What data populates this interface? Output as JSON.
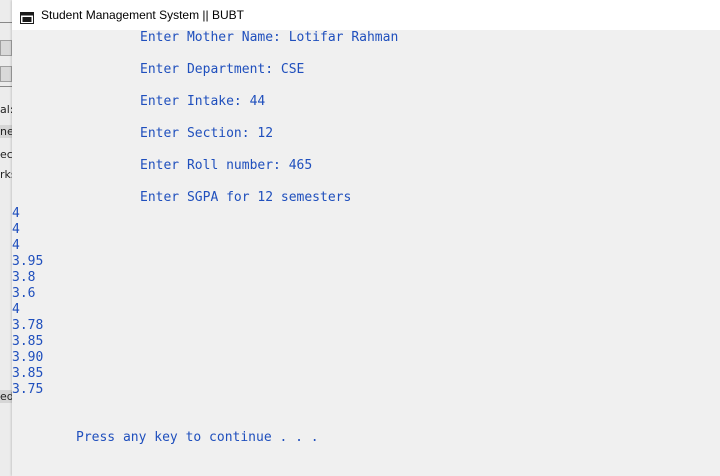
{
  "window": {
    "title": "Student Management System || BUBT",
    "icon": "console-app-icon"
  },
  "background_window": {
    "fragments": [
      "al:",
      "ner",
      "ect",
      "rks",
      "ed"
    ]
  },
  "console": {
    "prompts": [
      "Enter Mother Name: Lotifar Rahman",
      "Enter Department: CSE",
      "Enter Intake: 44",
      "Enter Section: 12",
      "Enter Roll number: 465",
      "Enter SGPA for 12 semesters"
    ],
    "sgpa_values": [
      "4",
      "4",
      "4",
      "3.95",
      "3.8",
      "3.6",
      "4",
      "3.78",
      "3.85",
      "3.90",
      "3.85",
      "3.75"
    ],
    "footer": "Press any key to continue . . ."
  },
  "colors": {
    "console_text": "#1f4fbd",
    "console_background": "#f0f0f0",
    "titlebar_background": "#ffffff"
  }
}
